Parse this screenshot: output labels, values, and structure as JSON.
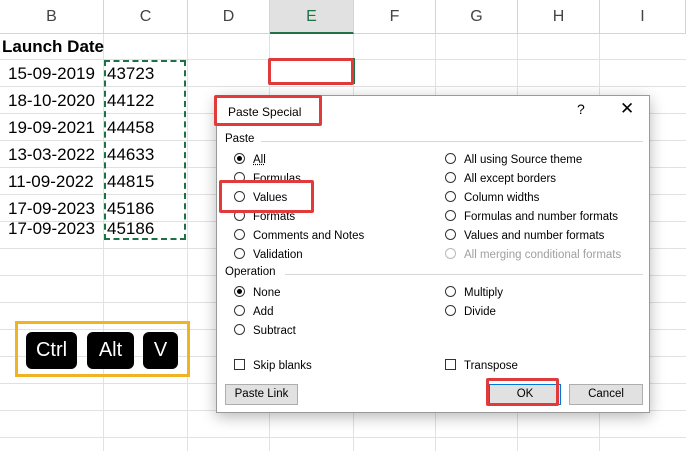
{
  "sheet": {
    "columns": [
      "B",
      "C",
      "D",
      "E",
      "F",
      "G",
      "H",
      "I"
    ],
    "header_cell": "Launch Date",
    "rows": [
      {
        "date": "15-09-2019",
        "value": "43723"
      },
      {
        "date": "18-10-2020",
        "value": "44122"
      },
      {
        "date": "19-09-2021",
        "value": "44458"
      },
      {
        "date": "13-03-2022",
        "value": "44633"
      },
      {
        "date": "11-09-2022",
        "value": "44815"
      },
      {
        "date": "17-09-2023",
        "value": "45186"
      },
      {
        "date": "17-09-2023",
        "value": "45186"
      }
    ]
  },
  "shortcut": {
    "keys": [
      "Ctrl",
      "Alt",
      "V"
    ]
  },
  "dialog": {
    "title": "Paste Special",
    "help": "?",
    "close": "✕",
    "paste_group": "Paste",
    "paste_left": [
      {
        "label": "All",
        "checked": true
      },
      {
        "label": "Formulas",
        "checked": false
      },
      {
        "label": "Values",
        "checked": false
      },
      {
        "label": "Formats",
        "checked": false
      },
      {
        "label": "Comments and Notes",
        "checked": false
      },
      {
        "label": "Validation",
        "checked": false
      }
    ],
    "paste_right": [
      {
        "label": "All using Source theme",
        "disabled": false
      },
      {
        "label": "All except borders",
        "disabled": false
      },
      {
        "label": "Column widths",
        "disabled": false
      },
      {
        "label": "Formulas and number formats",
        "disabled": false
      },
      {
        "label": "Values and number formats",
        "disabled": false
      },
      {
        "label": "All merging conditional formats",
        "disabled": true
      }
    ],
    "operation_group": "Operation",
    "operation_left": [
      {
        "label": "None",
        "checked": true
      },
      {
        "label": "Add",
        "checked": false
      },
      {
        "label": "Subtract",
        "checked": false
      }
    ],
    "operation_right": [
      {
        "label": "Multiply",
        "checked": false
      },
      {
        "label": "Divide",
        "checked": false
      }
    ],
    "skip_blanks": "Skip blanks",
    "transpose": "Transpose",
    "paste_link": "Paste Link",
    "ok": "OK",
    "cancel": "Cancel"
  },
  "colors": {
    "excel_green": "#217346",
    "highlight_red": "#e03a3a",
    "key_box_orange": "#f0b323"
  }
}
